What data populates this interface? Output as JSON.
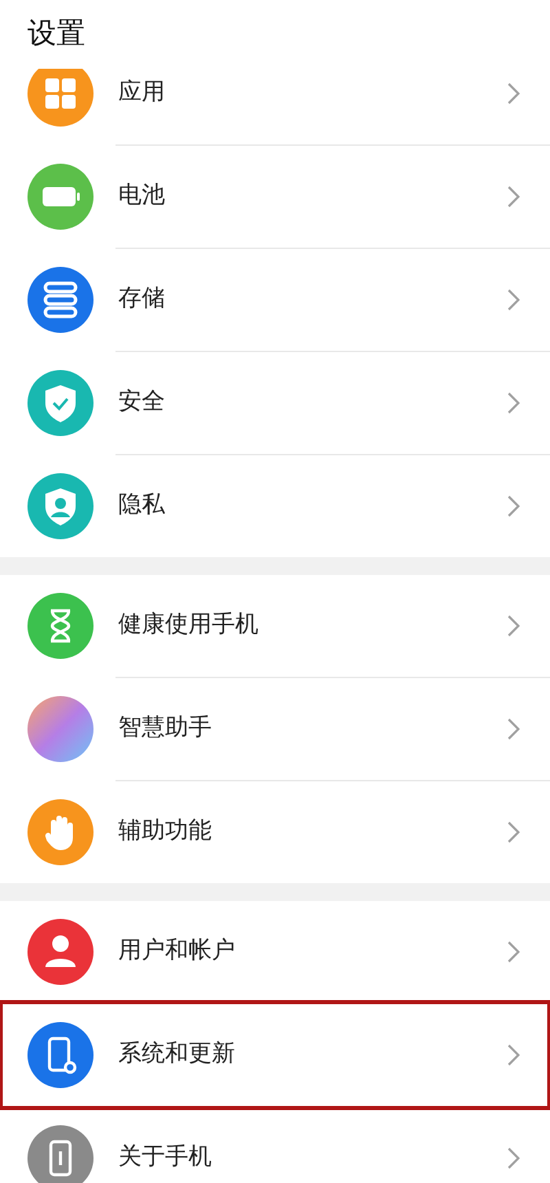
{
  "title": "设置",
  "groups": [
    {
      "items": [
        {
          "label": "应用",
          "kind": "apps",
          "highlighted": false
        },
        {
          "label": "电池",
          "kind": "battery",
          "highlighted": false
        },
        {
          "label": "存储",
          "kind": "storage",
          "highlighted": false
        },
        {
          "label": "安全",
          "kind": "security",
          "highlighted": false
        },
        {
          "label": "隐私",
          "kind": "privacy",
          "highlighted": false
        }
      ]
    },
    {
      "items": [
        {
          "label": "健康使用手机",
          "kind": "hourglass",
          "highlighted": false
        },
        {
          "label": "智慧助手",
          "kind": "assistant",
          "highlighted": false
        },
        {
          "label": "辅助功能",
          "kind": "hand",
          "highlighted": false
        }
      ]
    },
    {
      "items": [
        {
          "label": "用户和帐户",
          "kind": "user",
          "highlighted": false
        },
        {
          "label": "系统和更新",
          "kind": "system",
          "highlighted": true
        },
        {
          "label": "关于手机",
          "kind": "about",
          "highlighted": false
        }
      ]
    }
  ]
}
